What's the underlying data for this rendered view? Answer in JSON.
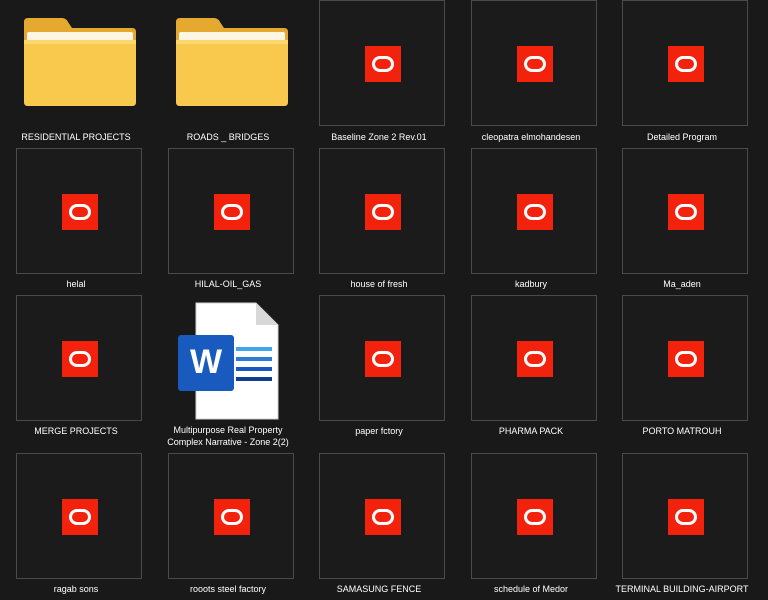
{
  "items": [
    {
      "name": "RESIDENTIAL PROJECTS",
      "icon": "folder-icon"
    },
    {
      "name": "ROADS _ BRIDGES",
      "icon": "folder-icon"
    },
    {
      "name": "Baseline Zone 2 Rev.01",
      "icon": "oracle-primavera-icon"
    },
    {
      "name": "cleopatra elmohandesen",
      "icon": "oracle-primavera-icon"
    },
    {
      "name": "Detailed Program",
      "icon": "oracle-primavera-icon"
    },
    {
      "name": "helal",
      "icon": "oracle-primavera-icon"
    },
    {
      "name": "HILAL-OIL_GAS",
      "icon": "oracle-primavera-icon"
    },
    {
      "name": "house of fresh",
      "icon": "oracle-primavera-icon"
    },
    {
      "name": "kadbury",
      "icon": "oracle-primavera-icon"
    },
    {
      "name": "Ma_aden",
      "icon": "oracle-primavera-icon"
    },
    {
      "name": "MERGE PROJECTS",
      "icon": "oracle-primavera-icon"
    },
    {
      "name": "Multipurpose Real Property Complex Narrative - Zone 2(2)",
      "icon": "word-document-icon"
    },
    {
      "name": "paper fctory",
      "icon": "oracle-primavera-icon"
    },
    {
      "name": "PHARMA PACK",
      "icon": "oracle-primavera-icon"
    },
    {
      "name": "PORTO MATROUH",
      "icon": "oracle-primavera-icon"
    },
    {
      "name": "ragab sons",
      "icon": "oracle-primavera-icon"
    },
    {
      "name": "rooots steel factory",
      "icon": "oracle-primavera-icon"
    },
    {
      "name": "SAMASUNG FENCE",
      "icon": "oracle-primavera-icon"
    },
    {
      "name": "schedule of Medor",
      "icon": "oracle-primavera-icon"
    },
    {
      "name": "TERMINAL BUILDING-AIRPORT",
      "icon": "oracle-primavera-icon"
    }
  ],
  "colors": {
    "background": "#191919",
    "tile_border": "#4a4a4a",
    "oracle_red": "#f2220d",
    "folder_yellow": "#f8c94c",
    "word_blue": "#185abd",
    "label_text": "#ffffff"
  }
}
